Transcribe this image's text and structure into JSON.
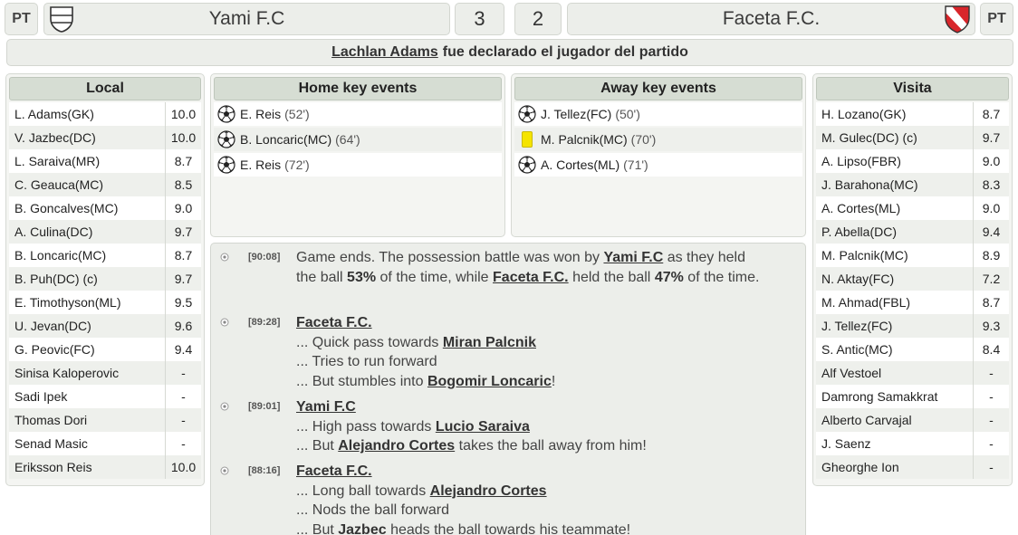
{
  "header": {
    "home_pt": "PT",
    "home_team": "Yami F.C",
    "home_score": "3",
    "away_score": "2",
    "away_team": "Faceta F.C.",
    "away_pt": "PT"
  },
  "motm": {
    "player": "Lachlan Adams",
    "text": "fue declarado el jugador del partido"
  },
  "home_panel": {
    "title": "Local",
    "players": [
      {
        "name": "L. Adams(GK)",
        "rating": "10.0"
      },
      {
        "name": "V. Jazbec(DC)",
        "rating": "10.0"
      },
      {
        "name": "L. Saraiva(MR)",
        "rating": "8.7"
      },
      {
        "name": "C. Geauca(MC)",
        "rating": "8.5"
      },
      {
        "name": "B. Goncalves(MC)",
        "rating": "9.0"
      },
      {
        "name": "A. Culina(DC)",
        "rating": "9.7"
      },
      {
        "name": "B. Loncaric(MC)",
        "rating": "8.7"
      },
      {
        "name": "B. Puh(DC) (c)",
        "rating": "9.7"
      },
      {
        "name": "E. Timothyson(ML)",
        "rating": "9.5"
      },
      {
        "name": "U. Jevan(DC)",
        "rating": "9.6"
      },
      {
        "name": "G. Peovic(FC)",
        "rating": "9.4"
      },
      {
        "name": "Sinisa Kaloperovic",
        "rating": "-"
      },
      {
        "name": "Sadi Ipek",
        "rating": "-"
      },
      {
        "name": "Thomas Dori",
        "rating": "-"
      },
      {
        "name": "Senad Masic",
        "rating": "-"
      },
      {
        "name": "Eriksson Reis",
        "rating": "10.0"
      }
    ]
  },
  "away_panel": {
    "title": "Visita",
    "players": [
      {
        "name": "H. Lozano(GK)",
        "rating": "8.7"
      },
      {
        "name": "M. Gulec(DC) (c)",
        "rating": "9.7"
      },
      {
        "name": "A. Lipso(FBR)",
        "rating": "9.0"
      },
      {
        "name": "J. Barahona(MC)",
        "rating": "8.3"
      },
      {
        "name": "A. Cortes(ML)",
        "rating": "9.0"
      },
      {
        "name": "P. Abella(DC)",
        "rating": "9.4"
      },
      {
        "name": "M. Palcnik(MC)",
        "rating": "8.9"
      },
      {
        "name": "N. Aktay(FC)",
        "rating": "7.2"
      },
      {
        "name": "M. Ahmad(FBL)",
        "rating": "8.7"
      },
      {
        "name": "J. Tellez(FC)",
        "rating": "9.3"
      },
      {
        "name": "S. Antic(MC)",
        "rating": "8.4"
      },
      {
        "name": "Alf Vestoel",
        "rating": "-"
      },
      {
        "name": "Damrong Samakkrat",
        "rating": "-"
      },
      {
        "name": "Alberto Carvajal",
        "rating": "-"
      },
      {
        "name": "J. Saenz",
        "rating": "-"
      },
      {
        "name": "Gheorghe Ion",
        "rating": "-"
      }
    ]
  },
  "home_events": {
    "title": "Home key events",
    "events": [
      {
        "icon": "ball-icon",
        "player": "E. Reis",
        "minute": "(52')"
      },
      {
        "icon": "ball-icon",
        "player": "B. Loncaric(MC)",
        "minute": "(64')"
      },
      {
        "icon": "ball-icon",
        "player": "E. Reis",
        "minute": "(72')"
      }
    ]
  },
  "away_events": {
    "title": "Away key events",
    "events": [
      {
        "icon": "ball-icon",
        "player": "J. Tellez(FC)",
        "minute": "(50')"
      },
      {
        "icon": "yellow-card-icon",
        "player": "M. Palcnik(MC)",
        "minute": "(70')"
      },
      {
        "icon": "ball-icon",
        "player": "A. Cortes(ML)",
        "minute": "(71')"
      }
    ]
  },
  "log": {
    "e1": {
      "time": "[90:08]",
      "t1": "Game ends. The possession battle was won by ",
      "team1": "Yami F.C",
      "t2": " as they held the ball ",
      "p1": "53%",
      "t3": " of the time, while ",
      "team2": "Faceta F.C.",
      "t4": " held the ball ",
      "p2": "47%",
      "t5": " of the time."
    },
    "e2": {
      "time": "[89:28]",
      "team": "Faceta F.C.",
      "l1a": "... Quick pass towards ",
      "l1p": "Miran Palcnik",
      "l2": "... Tries to run forward",
      "l3a": "... But stumbles into ",
      "l3p": "Bogomir Loncaric",
      "l3b": "!"
    },
    "e3": {
      "time": "[89:01]",
      "team": "Yami F.C",
      "l1a": "... High pass towards ",
      "l1p": "Lucio Saraiva",
      "l2a": "... But ",
      "l2p": "Alejandro Cortes",
      "l2b": " takes the ball away from him!"
    },
    "e4": {
      "time": "[88:16]",
      "team": "Faceta F.C.",
      "l1a": "... Long ball towards ",
      "l1p": "Alejandro Cortes",
      "l2": "... Nods the ball forward",
      "l3a": "... But ",
      "l3p": "Jazbec",
      "l3b": " heads the ball towards his teammate!"
    }
  }
}
